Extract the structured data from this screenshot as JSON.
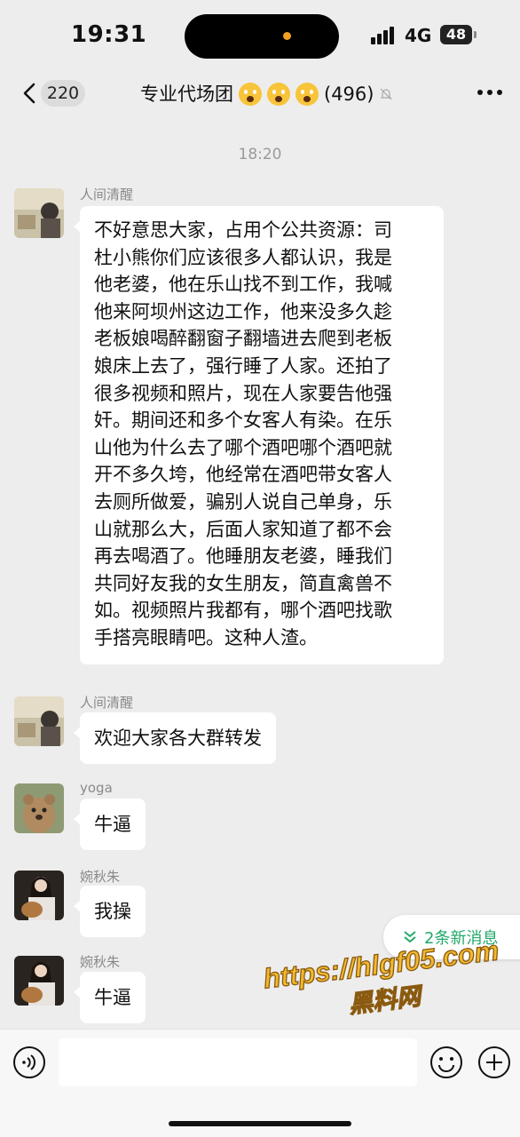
{
  "status_bar": {
    "time": "19:31",
    "network": "4G",
    "battery": "48"
  },
  "header": {
    "unread_count": "220",
    "title": "专业代场团",
    "member_count": "(496)",
    "title_emojis": [
      "scream-emoji",
      "scream-emoji",
      "scream-emoji"
    ]
  },
  "chat": {
    "timestamp": "18:20",
    "messages": [
      {
        "sender": "人间清醒",
        "lines": [
          "不好意思大家，占用个公共资源：司",
          "杜小熊你们应该很多人都认识，我是",
          "他老婆，他在乐山找不到工作，我喊",
          "他来阿坝州这边工作，他来没多久趁",
          "老板娘喝醉翻窗子翻墙进去爬到老板",
          "娘床上去了，强行睡了人家。还拍了",
          "很多视频和照片，现在人家要告他强",
          "奸。期间还和多个女客人有染。在乐",
          "山他为什么去了哪个酒吧哪个酒吧就",
          "开不多久垮，他经常在酒吧带女客人",
          "去厕所做爱，骗别人说自己单身，乐",
          "山就那么大，后面人家知道了都不会",
          "再去喝酒了。他睡朋友老婆，睡我们",
          "共同好友我的女生朋友，简直禽兽不",
          "如。视频照片我都有，哪个酒吧找歌",
          "手搭亮眼睛吧。这种人渣。"
        ]
      },
      {
        "sender": "人间清醒",
        "text": "欢迎大家各大群转发"
      },
      {
        "sender": "yoga",
        "text": "牛逼"
      },
      {
        "sender": "婉秋朱",
        "text": "我操"
      },
      {
        "sender": "婉秋朱",
        "text": "牛逼"
      }
    ]
  },
  "new_messages_button": "2条新消息",
  "watermark": {
    "url": "https://hlgf05.com",
    "name": "黑料网"
  },
  "input": {
    "value": "",
    "placeholder": ""
  },
  "colors": {
    "background": "#ededed",
    "bubble": "#ffffff",
    "accent_green": "#22a86a",
    "watermark_fill": "#f2b92e"
  }
}
